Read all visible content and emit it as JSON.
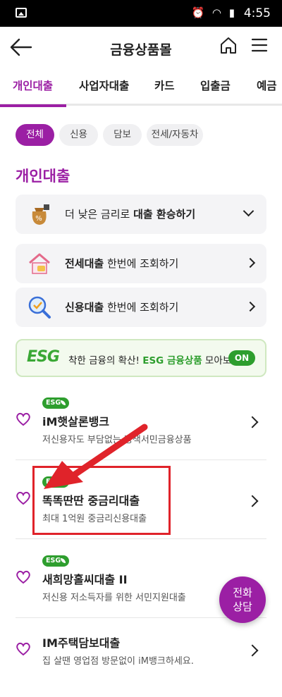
{
  "status_bar": {
    "time": "4:55"
  },
  "header": {
    "title": "금융상품몰"
  },
  "tabs": [
    "개인대출",
    "사업자대출",
    "카드",
    "입출금",
    "예금"
  ],
  "chips": [
    "전체",
    "신용",
    "담보",
    "전세/자동차"
  ],
  "section_title": "개인대출",
  "cards": [
    {
      "prefix": "더 낮은 금리로 ",
      "bold": "대출 환승하기",
      "suffix": ""
    },
    {
      "prefix": "",
      "bold": "전세대출",
      "suffix": " 한번에 조회하기"
    },
    {
      "prefix": "",
      "bold": "신용대출",
      "suffix": " 한번에 조회하기"
    }
  ],
  "esg_banner": {
    "logo": "ESG",
    "text_prefix": "착한 금융의 확산! ",
    "text_highlight": "ESG 금융상품",
    "text_suffix": " 모아보기",
    "toggle": "ON"
  },
  "products": [
    {
      "badge": "ESG",
      "name": "iM햇살론뱅크",
      "desc": "저신용자도 부담없는 정책서민금융상품"
    },
    {
      "badge": "ESG",
      "name": "똑똑딴딴 중금리대출",
      "desc": "최대 1억원 중금리신용대출"
    },
    {
      "badge": "ESG",
      "name": "새희망홀씨대출 II",
      "desc": "저신용 저소득자를 위한 서민지원대출"
    },
    {
      "badge": "",
      "name": "IM주택담보대출",
      "desc": "집 살땐 영업점 방문없이 iM뱅크하세요."
    }
  ],
  "fab": {
    "line1": "전화",
    "line2": "상담"
  },
  "colors": {
    "accent": "#9b1fa4",
    "esg_green": "#2e9e2e",
    "highlight_red": "#e0232a"
  }
}
